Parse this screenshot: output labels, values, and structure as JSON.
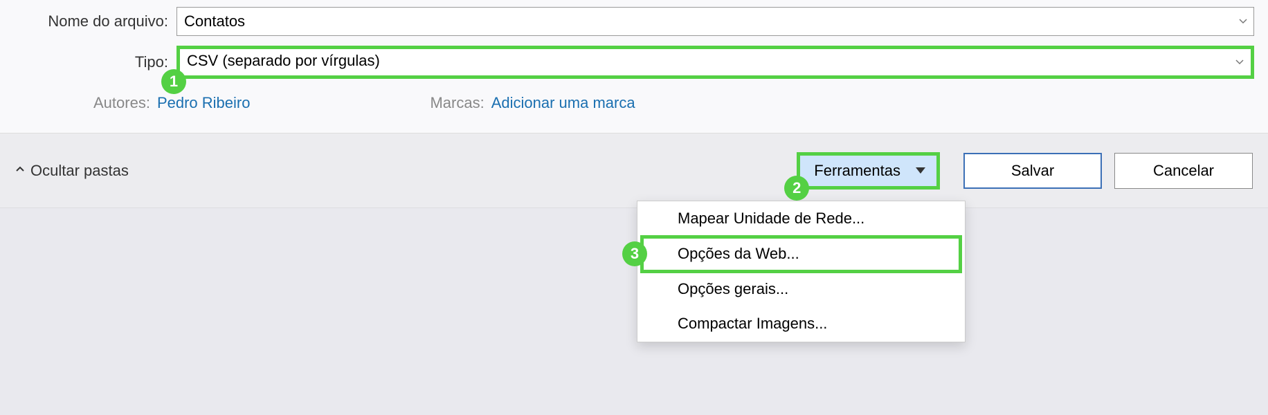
{
  "filename": {
    "label": "Nome do arquivo:",
    "value": "Contatos"
  },
  "filetype": {
    "label": "Tipo:",
    "value": "CSV (separado por vírgulas)"
  },
  "authors": {
    "label": "Autores:",
    "value": "Pedro Ribeiro"
  },
  "tags": {
    "label": "Marcas:",
    "value": "Adicionar uma marca"
  },
  "hide_folders_label": "Ocultar pastas",
  "tools_label": "Ferramentas",
  "save_label": "Salvar",
  "cancel_label": "Cancelar",
  "menu": {
    "map_drive": "Mapear Unidade de Rede...",
    "web_options": "Opções da Web...",
    "general_options": "Opções gerais...",
    "compress_images": "Compactar Imagens..."
  },
  "badges": {
    "one": "1",
    "two": "2",
    "three": "3"
  }
}
